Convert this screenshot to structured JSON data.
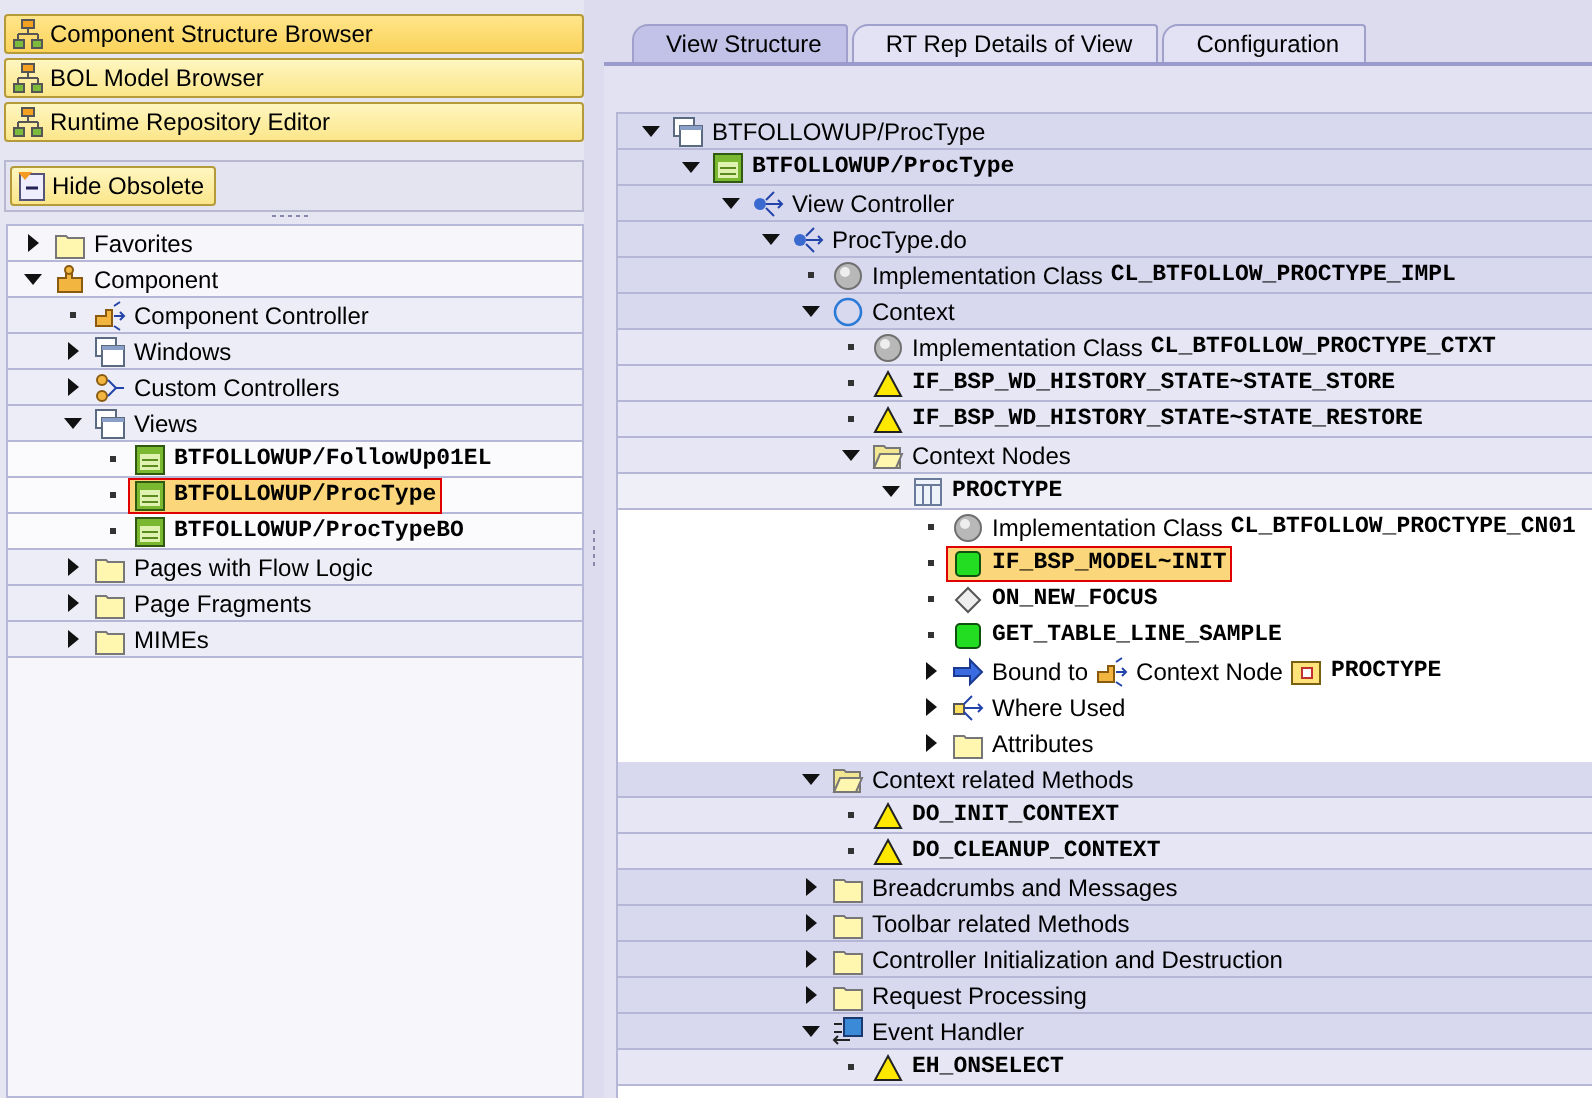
{
  "nav_buttons": [
    {
      "label": "Component Structure Browser",
      "selected": true
    },
    {
      "label": "BOL Model Browser",
      "selected": false
    },
    {
      "label": "Runtime Repository Editor",
      "selected": false
    }
  ],
  "hide_obsolete_button": {
    "label": "Hide Obsolete"
  },
  "left_tree": [
    {
      "kind": "folder",
      "parts": [
        {
          "kind": "text",
          "text": "Favorites"
        }
      ],
      "expanded": false,
      "selected": false
    },
    {
      "kind": "component",
      "parts": [
        {
          "kind": "text",
          "text": "Component"
        }
      ],
      "expanded": true,
      "selected": false,
      "children": [
        {
          "kind": "controller",
          "parts": [
            {
              "kind": "text",
              "text": "Component Controller"
            }
          ],
          "selected": false
        },
        {
          "kind": "windows",
          "parts": [
            {
              "kind": "text",
              "text": "Windows"
            }
          ],
          "expanded": false,
          "selected": false
        },
        {
          "kind": "controllers",
          "parts": [
            {
              "kind": "text",
              "text": "Custom Controllers"
            }
          ],
          "expanded": false,
          "selected": false
        },
        {
          "kind": "windows",
          "parts": [
            {
              "kind": "text",
              "text": "Views"
            }
          ],
          "expanded": true,
          "selected": false,
          "children": [
            {
              "kind": "view",
              "parts": [
                {
                  "kind": "code",
                  "text": "BTFOLLOWUP/FollowUp01EL"
                }
              ],
              "selected": false
            },
            {
              "kind": "view",
              "parts": [
                {
                  "kind": "code",
                  "text": "BTFOLLOWUP/ProcType"
                }
              ],
              "selected": true
            },
            {
              "kind": "view",
              "parts": [
                {
                  "kind": "code",
                  "text": "BTFOLLOWUP/ProcTypeBO"
                }
              ],
              "selected": false
            }
          ]
        },
        {
          "kind": "folder",
          "parts": [
            {
              "kind": "text",
              "text": "Pages with Flow Logic"
            }
          ],
          "expanded": false,
          "selected": false
        },
        {
          "kind": "folder",
          "parts": [
            {
              "kind": "text",
              "text": "Page Fragments"
            }
          ],
          "expanded": false,
          "selected": false
        },
        {
          "kind": "folder",
          "parts": [
            {
              "kind": "text",
              "text": "MIMEs"
            }
          ],
          "expanded": false,
          "selected": false
        }
      ]
    }
  ],
  "tabs": [
    {
      "label": "View Structure",
      "selected": true
    },
    {
      "label": "RT Rep Details of View",
      "selected": false
    },
    {
      "label": "Configuration",
      "selected": false
    }
  ],
  "view_tree": [
    {
      "kind": "windows",
      "parts": [
        {
          "kind": "text",
          "text": "BTFOLLOWUP/ProcType"
        }
      ],
      "expanded": true,
      "selected": false,
      "children": [
        {
          "kind": "view",
          "parts": [
            {
              "kind": "code",
              "text": "BTFOLLOWUP/ProcType"
            }
          ],
          "expanded": true,
          "selected": false,
          "children": [
            {
              "kind": "branch",
              "parts": [
                {
                  "kind": "text",
                  "text": "View Controller"
                }
              ],
              "expanded": true,
              "selected": false,
              "children": [
                {
                  "kind": "branch",
                  "parts": [
                    {
                      "kind": "text",
                      "text": "ProcType.do"
                    }
                  ],
                  "expanded": true,
                  "selected": false,
                  "children": [
                    {
                      "kind": "class",
                      "parts": [
                        {
                          "kind": "text",
                          "text": "Implementation Class"
                        },
                        {
                          "kind": "code",
                          "text": "CL_BTFOLLOW_PROCTYPE_IMPL"
                        }
                      ],
                      "selected": false
                    },
                    {
                      "kind": "context",
                      "parts": [
                        {
                          "kind": "text",
                          "text": "Context"
                        }
                      ],
                      "expanded": true,
                      "selected": false,
                      "children": [
                        {
                          "kind": "class",
                          "parts": [
                            {
                              "kind": "text",
                              "text": "Implementation Class"
                            },
                            {
                              "kind": "code",
                              "text": "CL_BTFOLLOW_PROCTYPE_CTXT"
                            }
                          ],
                          "selected": false
                        },
                        {
                          "kind": "warning",
                          "parts": [
                            {
                              "kind": "code",
                              "text": "IF_BSP_WD_HISTORY_STATE~STATE_STORE"
                            }
                          ],
                          "selected": false
                        },
                        {
                          "kind": "warning",
                          "parts": [
                            {
                              "kind": "code",
                              "text": "IF_BSP_WD_HISTORY_STATE~STATE_RESTORE"
                            }
                          ],
                          "selected": false
                        },
                        {
                          "kind": "folder-open",
                          "parts": [
                            {
                              "kind": "text",
                              "text": "Context Nodes"
                            }
                          ],
                          "expanded": true,
                          "selected": false,
                          "children": [
                            {
                              "kind": "table",
                              "parts": [
                                {
                                  "kind": "code",
                                  "text": "PROCTYPE"
                                }
                              ],
                              "expanded": true,
                              "selected": false,
                              "children": [
                                {
                                  "kind": "class",
                                  "parts": [
                                    {
                                      "kind": "text",
                                      "text": "Implementation Class"
                                    },
                                    {
                                      "kind": "code",
                                      "text": "CL_BTFOLLOW_PROCTYPE_CN01"
                                    }
                                  ],
                                  "selected": false
                                },
                                {
                                  "kind": "method",
                                  "parts": [
                                    {
                                      "kind": "code",
                                      "text": "IF_BSP_MODEL~INIT"
                                    }
                                  ],
                                  "selected": true
                                },
                                {
                                  "kind": "diamond",
                                  "parts": [
                                    {
                                      "kind": "code",
                                      "text": "ON_NEW_FOCUS"
                                    }
                                  ],
                                  "selected": false
                                },
                                {
                                  "kind": "method",
                                  "parts": [
                                    {
                                      "kind": "code",
                                      "text": "GET_TABLE_LINE_SAMPLE"
                                    }
                                  ],
                                  "selected": false
                                },
                                {
                                  "kind": "arrow",
                                  "parts": [
                                    {
                                      "kind": "text",
                                      "text": "Bound to"
                                    },
                                    {
                                      "kind": "controller"
                                    },
                                    {
                                      "kind": "text",
                                      "text": "Context Node"
                                    },
                                    {
                                      "kind": "node"
                                    },
                                    {
                                      "kind": "code",
                                      "text": "PROCTYPE"
                                    }
                                  ],
                                  "expanded": false,
                                  "selected": false
                                },
                                {
                                  "kind": "where-used",
                                  "parts": [
                                    {
                                      "kind": "text",
                                      "text": "Where Used"
                                    }
                                  ],
                                  "expanded": false,
                                  "selected": false
                                },
                                {
                                  "kind": "folder",
                                  "parts": [
                                    {
                                      "kind": "text",
                                      "text": "Attributes"
                                    }
                                  ],
                                  "expanded": false,
                                  "selected": false
                                }
                              ]
                            }
                          ]
                        }
                      ]
                    },
                    {
                      "kind": "folder-open",
                      "parts": [
                        {
                          "kind": "text",
                          "text": "Context related Methods"
                        }
                      ],
                      "expanded": true,
                      "selected": false,
                      "children": [
                        {
                          "kind": "warning",
                          "parts": [
                            {
                              "kind": "code",
                              "text": "DO_INIT_CONTEXT"
                            }
                          ],
                          "selected": false
                        },
                        {
                          "kind": "warning",
                          "parts": [
                            {
                              "kind": "code",
                              "text": "DO_CLEANUP_CONTEXT"
                            }
                          ],
                          "selected": false
                        }
                      ]
                    },
                    {
                      "kind": "folder",
                      "parts": [
                        {
                          "kind": "text",
                          "text": "Breadcrumbs and Messages"
                        }
                      ],
                      "expanded": false,
                      "selected": false
                    },
                    {
                      "kind": "folder",
                      "parts": [
                        {
                          "kind": "text",
                          "text": "Toolbar related Methods"
                        }
                      ],
                      "expanded": false,
                      "selected": false
                    },
                    {
                      "kind": "folder",
                      "parts": [
                        {
                          "kind": "text",
                          "text": "Controller Initialization and Destruction"
                        }
                      ],
                      "expanded": false,
                      "selected": false
                    },
                    {
                      "kind": "folder",
                      "parts": [
                        {
                          "kind": "text",
                          "text": "Request Processing"
                        }
                      ],
                      "expanded": false,
                      "selected": false
                    },
                    {
                      "kind": "event",
                      "parts": [
                        {
                          "kind": "text",
                          "text": "Event Handler"
                        }
                      ],
                      "expanded": true,
                      "selected": false,
                      "children": [
                        {
                          "kind": "warning",
                          "parts": [
                            {
                              "kind": "code",
                              "text": "EH_ONSELECT"
                            }
                          ],
                          "selected": false
                        }
                      ]
                    }
                  ]
                }
              ]
            }
          ]
        }
      ]
    }
  ]
}
